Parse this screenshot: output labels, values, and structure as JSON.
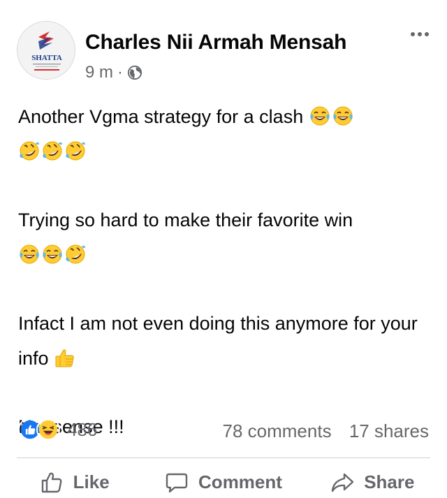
{
  "post": {
    "author": "Charles Nii Armah Mensah",
    "avatar_text": "SHATTA",
    "time": "9 m",
    "separator": "·",
    "privacy_icon": "globe-icon",
    "more_icon": "more-icon"
  },
  "content": {
    "paragraphs": [
      {
        "text": "Another Vgma strategy for a clash",
        "emojis": [
          "tears-of-joy",
          "tears-of-joy",
          "rofl",
          "rofl",
          "rofl"
        ]
      },
      {
        "text": "Trying so hard to make their favorite win",
        "emojis": [
          "tears-of-joy",
          "tears-of-joy",
          "rofl"
        ]
      },
      {
        "text": "Infact I am not even doing this anymore for your info",
        "emojis": [
          "thumbs-up"
        ]
      },
      {
        "text": "Nonsense !!!",
        "emojis": []
      }
    ]
  },
  "stats": {
    "reaction_icons": [
      "like-reaction-icon",
      "haha-reaction-icon"
    ],
    "reaction_count": "486",
    "comments": "78 comments",
    "shares": "17 shares"
  },
  "actions": {
    "like_label": "Like",
    "comment_label": "Comment",
    "share_label": "Share"
  },
  "colors": {
    "text": "#050505",
    "secondary": "#65676b",
    "like_blue": "#1877f2",
    "emoji_yellow": "#ffcc33",
    "divider": "#ced0d4"
  }
}
